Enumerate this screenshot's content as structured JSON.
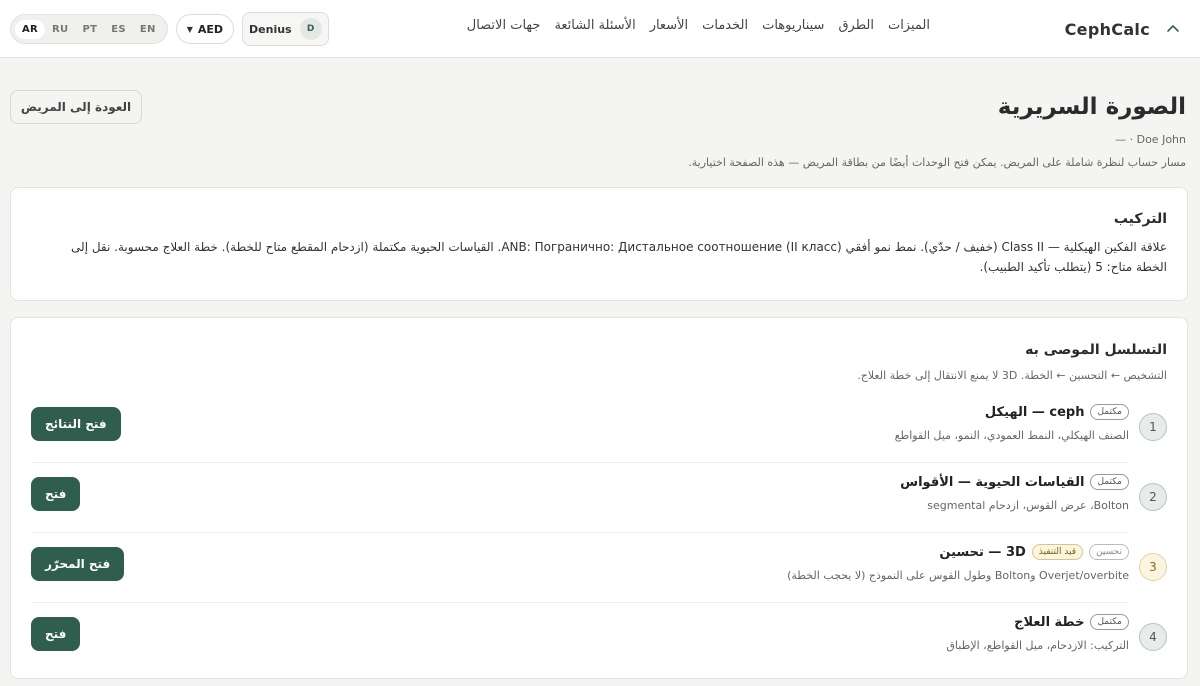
{
  "brand": {
    "name": "CephCalc",
    "logo_icon": "chevron-up-icon"
  },
  "nav": {
    "items": [
      "الميزات",
      "الطرق",
      "سيناريوهات",
      "الخدمات",
      "الأسعار",
      "الأسئلة الشائعة",
      "جهات الاتصال"
    ]
  },
  "controls": {
    "languages": [
      "AR",
      "RU",
      "PT",
      "ES",
      "EN"
    ],
    "active_language": "AR",
    "currency": "AED",
    "user_name": "Denius",
    "user_initial": "D"
  },
  "header": {
    "title": "الصورة السريرية",
    "patient_line": "Doe John · —",
    "description": "مسار حساب لنظرة شاملة على المريض. يمكن فتح الوحدات أيضًا من بطاقة المريض — هذه الصفحة اختيارية.",
    "back_button": "العودة إلى المريض"
  },
  "summary": {
    "title": "التركيب",
    "text": "علاقة الفكين الهيكلية — Class II (خفيف / حدّي). نمط نمو أفقي ANB: Погранично: Дистальное соотношение (II класс). القياسات الحيوية مكتملة (ازدحام المقطع متاح للخطة). خطة العلاج محسوبة. نقل إلى الخطة متاح: 5 (يتطلب تأكيد الطبيب)."
  },
  "sequence": {
    "title": "التسلسل الموصى به",
    "subtitle": "التشخيص ← التحسين ← الخطة. 3D لا يمنع الانتقال إلى خطة العلاج.",
    "steps": [
      {
        "num": "1",
        "name": "ceph — الهيكل",
        "badges": [
          "مكتمل"
        ],
        "desc": "الصنف الهيكلي، النمط العمودي، النمو، ميل القواطع",
        "button": "فتح النتائج"
      },
      {
        "num": "2",
        "name": "القياسات الحيوية — الأقواس",
        "badges": [
          "مكتمل"
        ],
        "desc": "Bolton، عرض القوس، ازدحام segmental",
        "button": "فتح"
      },
      {
        "num": "3",
        "name": "3D — تحسين",
        "badges": [
          "قيد التنفيذ",
          "تحسين"
        ],
        "desc": "Overjet/overbite وBolton وطول القوس على النموذج (لا يحجب الخطة)",
        "button": "فتح المحرّر"
      },
      {
        "num": "4",
        "name": "خطة العلاج",
        "badges": [
          "مكتمل"
        ],
        "desc": "التركيب: الازدحام، ميل القواطع، الإطباق",
        "button": "فتح"
      }
    ]
  }
}
